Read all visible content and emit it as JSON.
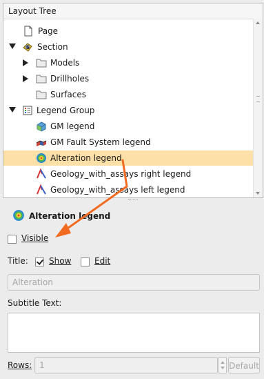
{
  "tree": {
    "header": "Layout Tree",
    "items": [
      {
        "label": "Page",
        "icon": "page-icon"
      },
      {
        "label": "Section",
        "icon": "section-icon"
      },
      {
        "label": "Models",
        "icon": "folder-icon"
      },
      {
        "label": "Drillholes",
        "icon": "folder-icon"
      },
      {
        "label": "Surfaces",
        "icon": "folder-icon"
      },
      {
        "label": "Legend Group",
        "icon": "legend-group-icon"
      },
      {
        "label": "GM legend",
        "icon": "gm-legend-icon"
      },
      {
        "label": "GM Fault System legend",
        "icon": "fault-system-icon"
      },
      {
        "label": "Alteration legend",
        "icon": "alteration-legend-icon",
        "selected": true
      },
      {
        "label": "Geology_with_assays right legend",
        "icon": "assay-legend-icon"
      },
      {
        "label": "Geology_with_assays left legend",
        "icon": "assay-legend-icon"
      }
    ]
  },
  "props": {
    "title": "Alteration legend",
    "visible_label": "Visible",
    "visible_checked": false,
    "title_label": "Title:",
    "show_label": "Show",
    "show_checked": true,
    "edit_label": "Edit",
    "edit_checked": false,
    "title_value": "Alteration",
    "subtitle_label": "Subtitle Text:",
    "subtitle_value": "",
    "rows_label": "Rows:",
    "rows_value": "1",
    "default_label": "Default"
  },
  "colors": {
    "selection": "#fde0a8",
    "annotation_arrow": "#f26b21"
  }
}
